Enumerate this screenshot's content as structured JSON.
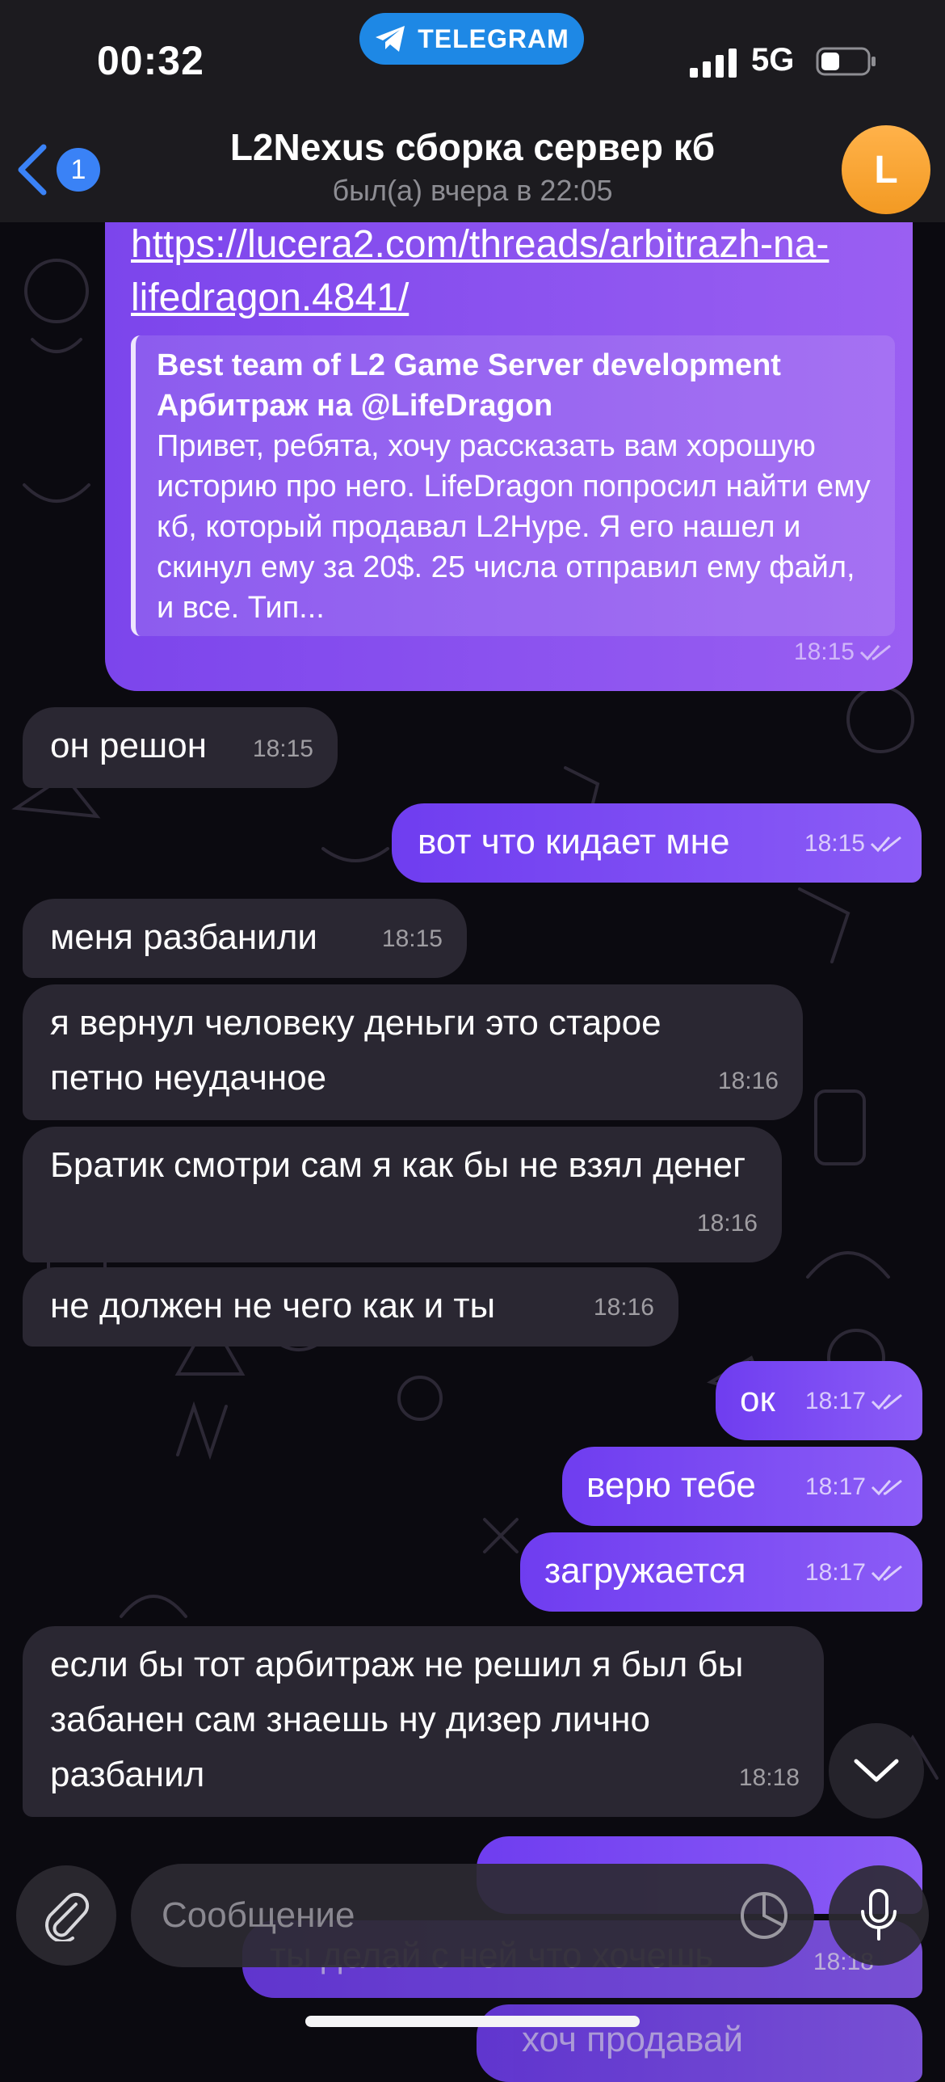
{
  "status_bar": {
    "time": "00:32",
    "app_pill": "TELEGRAM",
    "network": "5G"
  },
  "header": {
    "back_badge_count": "1",
    "title": "L2Nexus сборка сервер кб",
    "subtitle": "был(а) вчера в 22:05",
    "avatar_letter": "L"
  },
  "link_message": {
    "url_text": "https://lucera2.com/threads/arbitrazh-na-lifedragon.4841/",
    "preview_site": "Best team of L2 Game Server development",
    "preview_title": "Арбитраж на @LifeDragon",
    "preview_body": "Привет, ребята, хочу рассказать вам хорошую историю про него. LifeDragon попросил найти ему кб, который продавал L2Hype. Я его нашел и скинул ему за 20$. 25 числа отправил ему файл, и все. Тип...",
    "time": "18:15"
  },
  "messages": [
    {
      "dir": "in",
      "text": "он решон",
      "time": "18:15"
    },
    {
      "dir": "out",
      "text": "вот что кидает мне",
      "time": "18:15"
    },
    {
      "dir": "in",
      "text": "меня разбанили",
      "time": "18:15"
    },
    {
      "dir": "in",
      "text": "я вернул человеку деньги это старое петно неудачное",
      "time": "18:16"
    },
    {
      "dir": "in",
      "text": "Братик смотри сам я как бы не взял денег",
      "time": "18:16"
    },
    {
      "dir": "in",
      "text": "не должен не чего как и ты",
      "time": "18:16"
    },
    {
      "dir": "out",
      "text": "ок",
      "time": "18:17"
    },
    {
      "dir": "out",
      "text": "верю тебе",
      "time": "18:17"
    },
    {
      "dir": "out",
      "text": "загружается",
      "time": "18:17"
    },
    {
      "dir": "in",
      "text": "если бы тот арбитраж не решил я был бы забанен сам знаешь ну дизер лично разбанил",
      "time": "18:18"
    }
  ],
  "behind_composer": {
    "text1": "ты делай с ней что хочешь",
    "time1": "18:18",
    "text2": "хоч продавай"
  },
  "composer": {
    "placeholder": "Сообщение"
  },
  "colors": {
    "header_bg": "#1c1b1f",
    "incoming_bubble": "#2a2732",
    "outgoing_bubble_start": "#6f3df0",
    "outgoing_bubble_end": "#8b5cf6",
    "telegram_pill": "#1e88e5",
    "avatar": "#f5a233",
    "back_badge": "#3a82f6"
  },
  "icons": [
    "telegram-plane-icon",
    "signal-bars-icon",
    "battery-icon",
    "back-chevron-icon",
    "read-ticks-icon",
    "paperclip-icon",
    "sticker-icon",
    "microphone-icon",
    "chevron-down-icon"
  ]
}
